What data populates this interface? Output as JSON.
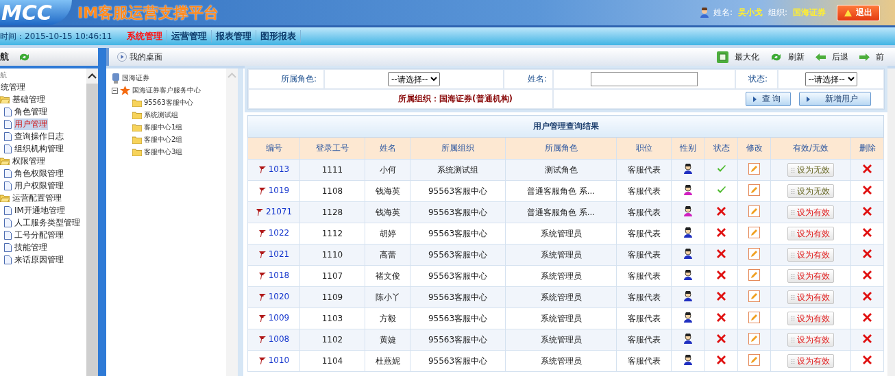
{
  "header": {
    "logo": "MCC",
    "title": "IM客服运营支撑平台",
    "user_label": "姓名:",
    "user_name": "吴小戈",
    "org_label": "组织:",
    "org_name": "国海证券",
    "logout": "退出"
  },
  "navbar": {
    "time": "时间：2015-10-15 10:46:11",
    "menus": [
      {
        "label": "系统管理",
        "selected": true
      },
      {
        "label": "运营管理",
        "selected": false
      },
      {
        "label": "报表管理",
        "selected": false
      },
      {
        "label": "图形报表",
        "selected": false
      }
    ]
  },
  "sidebar": {
    "title": "航",
    "subtitle": "航",
    "tree": [
      {
        "label": "统管理",
        "children": [
          {
            "label": "基础管理",
            "expanded": true,
            "children": [
              {
                "label": "角色管理",
                "selected": false
              },
              {
                "label": "用户管理",
                "selected": true
              },
              {
                "label": "查询操作日志",
                "selected": false
              },
              {
                "label": "组织机构管理",
                "selected": false
              }
            ]
          },
          {
            "label": "权限管理",
            "expanded": true,
            "children": [
              {
                "label": "角色权限管理",
                "selected": false
              },
              {
                "label": "用户权限管理",
                "selected": false
              }
            ]
          },
          {
            "label": "运营配置管理",
            "expanded": true,
            "children": [
              {
                "label": "IM开通地管理",
                "selected": false
              },
              {
                "label": "人工服务类型管理",
                "selected": false
              },
              {
                "label": "工号分配管理",
                "selected": false
              },
              {
                "label": "技能管理",
                "selected": false
              },
              {
                "label": "来话原因管理",
                "selected": false
              }
            ]
          }
        ]
      }
    ]
  },
  "toolbar": {
    "tab": "我的桌面",
    "actions": [
      {
        "kind": "maximize",
        "label": "最大化"
      },
      {
        "kind": "refresh",
        "label": "刷新"
      },
      {
        "kind": "back",
        "label": "后退"
      },
      {
        "kind": "forward",
        "label": "前"
      }
    ]
  },
  "org_tree": {
    "root": "国海证券",
    "node": {
      "label": "国海证券客户服务中心",
      "expanded": true,
      "children": [
        "95563客服中心",
        "系统测试组",
        "客服中心1组",
        "客服中心2组",
        "客服中心3组"
      ]
    }
  },
  "filter": {
    "role_label": "所属角色:",
    "role_value": "--请选择--",
    "name_label": "姓名:",
    "status_label": "状态:",
    "status_value": "--请选择--",
    "org_text": "所属组织：国海证券(普通机构)",
    "buttons": [
      "查 询",
      "新增用户"
    ]
  },
  "results": {
    "title": "用户管理查询结果",
    "columns": [
      "编号",
      "登录工号",
      "姓名",
      "所属组织",
      "所属角色",
      "职位",
      "性别",
      "状态",
      "修改",
      "有效/无效",
      "删除"
    ],
    "rows": [
      {
        "id": "1013",
        "login": "1111",
        "name": "小何",
        "org": "系统测试组",
        "role": "测试角色",
        "position": "客服代表",
        "color": "#2030c0",
        "active": true,
        "toggle": "设为无效"
      },
      {
        "id": "1019",
        "login": "1108",
        "name": "钱海英",
        "org": "95563客服中心",
        "role": "普通客服角色 系...",
        "position": "客服代表",
        "color": "#d020c0",
        "active": true,
        "toggle": "设为无效"
      },
      {
        "id": "21071",
        "login": "1128",
        "name": "钱海英",
        "org": "95563客服中心",
        "role": "普通客服角色 系...",
        "position": "客服代表",
        "color": "#d020c0",
        "active": false,
        "toggle": "设为有效"
      },
      {
        "id": "1022",
        "login": "1112",
        "name": "胡婷",
        "org": "95563客服中心",
        "role": "系统管理员",
        "position": "客服代表",
        "color": "#2030c0",
        "active": false,
        "toggle": "设为有效"
      },
      {
        "id": "1021",
        "login": "1110",
        "name": "高蕾",
        "org": "95563客服中心",
        "role": "系统管理员",
        "position": "客服代表",
        "color": "#2030c0",
        "active": false,
        "toggle": "设为有效"
      },
      {
        "id": "1018",
        "login": "1107",
        "name": "褚文俊",
        "org": "95563客服中心",
        "role": "系统管理员",
        "position": "客服代表",
        "color": "#2030c0",
        "active": false,
        "toggle": "设为有效"
      },
      {
        "id": "1020",
        "login": "1109",
        "name": "陈小丫",
        "org": "95563客服中心",
        "role": "系统管理员",
        "position": "客服代表",
        "color": "#2030c0",
        "active": false,
        "toggle": "设为有效"
      },
      {
        "id": "1009",
        "login": "1103",
        "name": "方毅",
        "org": "95563客服中心",
        "role": "系统管理员",
        "position": "客服代表",
        "color": "#2030c0",
        "active": false,
        "toggle": "设为有效"
      },
      {
        "id": "1008",
        "login": "1102",
        "name": "黄婕",
        "org": "95563客服中心",
        "role": "系统管理员",
        "position": "客服代表",
        "color": "#2030c0",
        "active": false,
        "toggle": "设为有效"
      },
      {
        "id": "1010",
        "login": "1104",
        "name": "杜燕妮",
        "org": "95563客服中心",
        "role": "系统管理员",
        "position": "客服代表",
        "color": "#2030c0",
        "active": false,
        "toggle": "设为有效"
      }
    ]
  }
}
